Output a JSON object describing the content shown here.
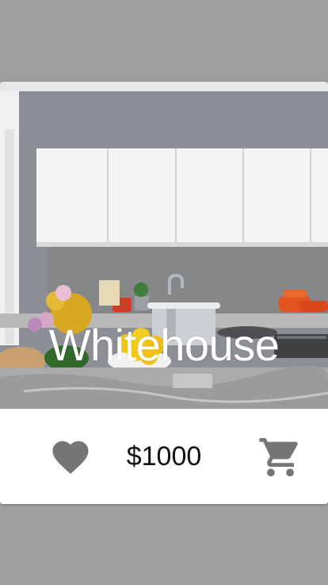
{
  "product": {
    "title": "Whitehouse",
    "price": "$1000"
  },
  "icons": {
    "favorite": "heart-icon",
    "cart": "shopping-cart-icon"
  },
  "colors": {
    "background": "#9e9e9e",
    "card": "#ffffff",
    "icon": "#757575",
    "title": "#ffffff"
  }
}
